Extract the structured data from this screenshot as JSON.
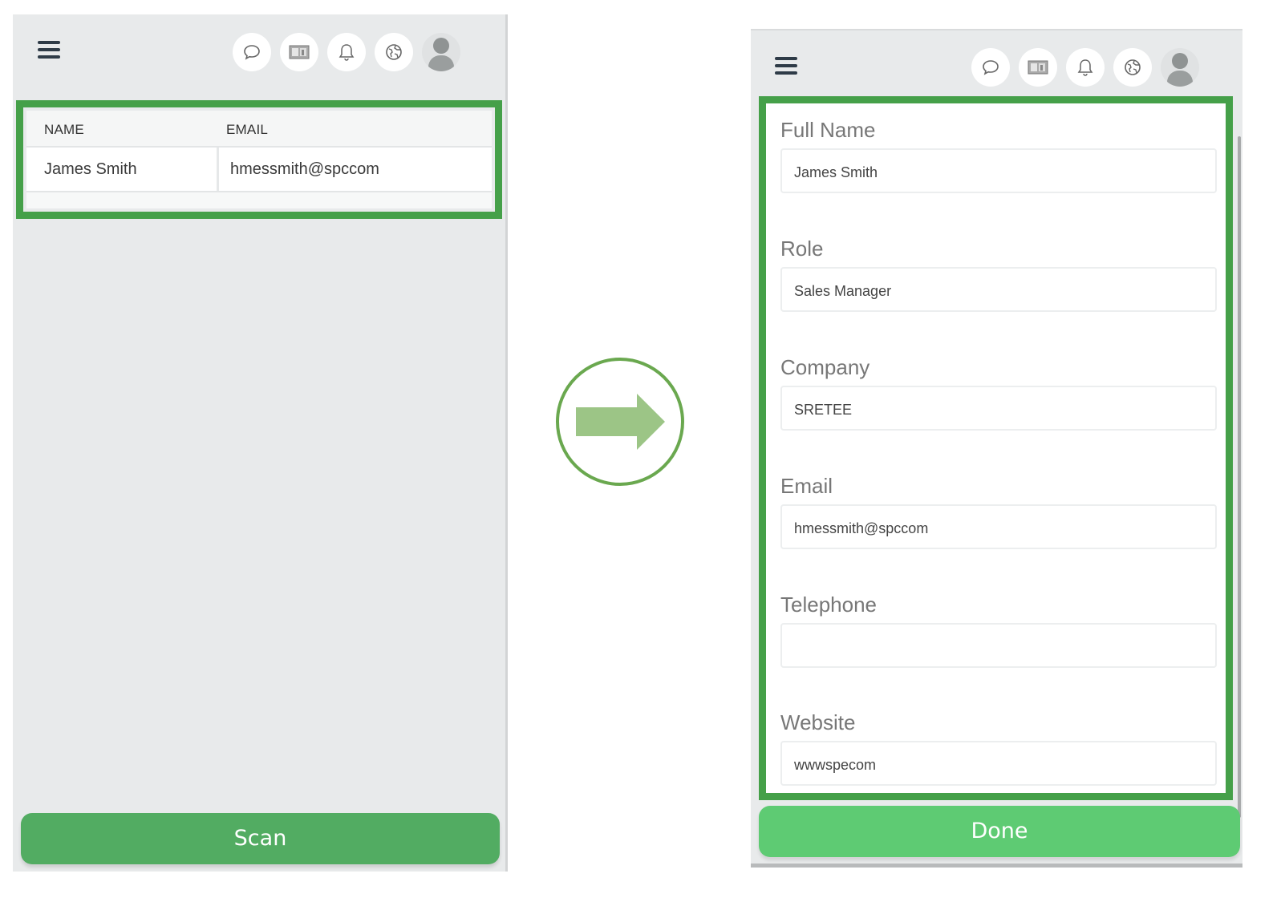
{
  "left_screen": {
    "toolbar_icons": [
      "chat-icon",
      "id-card-icon",
      "bell-icon",
      "globe-icon",
      "avatar"
    ],
    "table": {
      "columns": [
        "NAME",
        "EMAIL"
      ],
      "rows": [
        {
          "name": "James Smith",
          "email": "hmessmith@spccom"
        }
      ]
    },
    "primary_button": "Scan"
  },
  "transition": {
    "icon": "arrow-right-icon"
  },
  "right_screen": {
    "toolbar_icons": [
      "chat-icon",
      "id-card-icon",
      "bell-icon",
      "globe-icon",
      "avatar"
    ],
    "form": {
      "fields": [
        {
          "label": "Full Name",
          "value": "James Smith"
        },
        {
          "label": "Role",
          "value": "Sales Manager"
        },
        {
          "label": "Company",
          "value": "SRETEE"
        },
        {
          "label": "Email",
          "value": "hmessmith@spccom"
        },
        {
          "label": "Telephone",
          "value": ""
        },
        {
          "label": "Website",
          "value": "wwwspecom"
        }
      ]
    },
    "primary_button": "Done"
  },
  "colors": {
    "highlight_border": "#45a049",
    "scan_button": "#52ac62",
    "done_button": "#5ecb73",
    "arrow_fill": "#9cc586",
    "arrow_circle": "#6aa84f",
    "screen_background": "#e8eaeb"
  }
}
